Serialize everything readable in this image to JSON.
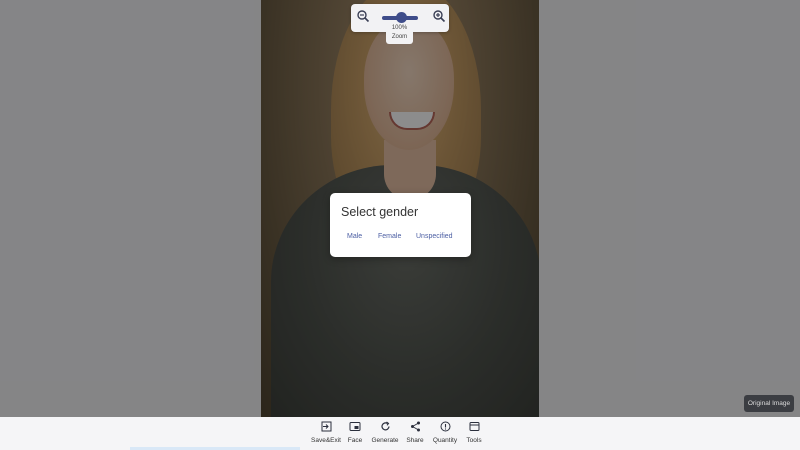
{
  "zoom": {
    "value_label": "100%",
    "caption": "Zoom",
    "level_percent": 100
  },
  "dialog": {
    "title": "Select gender",
    "options": [
      "Male",
      "Female",
      "Unspecified"
    ]
  },
  "original_image_button": "Original Image",
  "toolbar": {
    "items": [
      {
        "label": "Save&Exit",
        "icon": "exit-icon"
      },
      {
        "label": "Face",
        "icon": "face-icon"
      },
      {
        "label": "Generate",
        "icon": "refresh-icon"
      },
      {
        "label": "Share",
        "icon": "share-icon"
      },
      {
        "label": "Quantity",
        "icon": "info-icon"
      },
      {
        "label": "Tools",
        "icon": "tools-icon"
      }
    ]
  },
  "colors": {
    "accent": "#3f4d8a",
    "link": "#4b5ea3",
    "overlay": "rgba(0,0,0,0.45)"
  }
}
